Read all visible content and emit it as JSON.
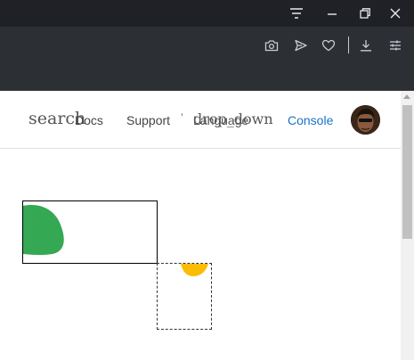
{
  "window_controls": {
    "menu_icon": "filter-menu-icon",
    "minimize_icon": "minimize-icon",
    "restore_icon": "restore-icon",
    "close_icon": "close-icon"
  },
  "toolbar": {
    "icons": [
      "camera-icon",
      "send-icon",
      "heart-icon",
      "download-icon",
      "sliders-icon"
    ]
  },
  "page": {
    "search_label": "search",
    "nav": {
      "docs": "Docs",
      "support": "Support",
      "language": "Language",
      "drop_down": "drop_down",
      "console": "Console"
    }
  },
  "colors": {
    "titlebar": "#1f2126",
    "toolbar": "#2c3035",
    "console_link": "#1a73c8",
    "green_shape": "#34a853",
    "yellow_shape": "#fbbc05"
  }
}
